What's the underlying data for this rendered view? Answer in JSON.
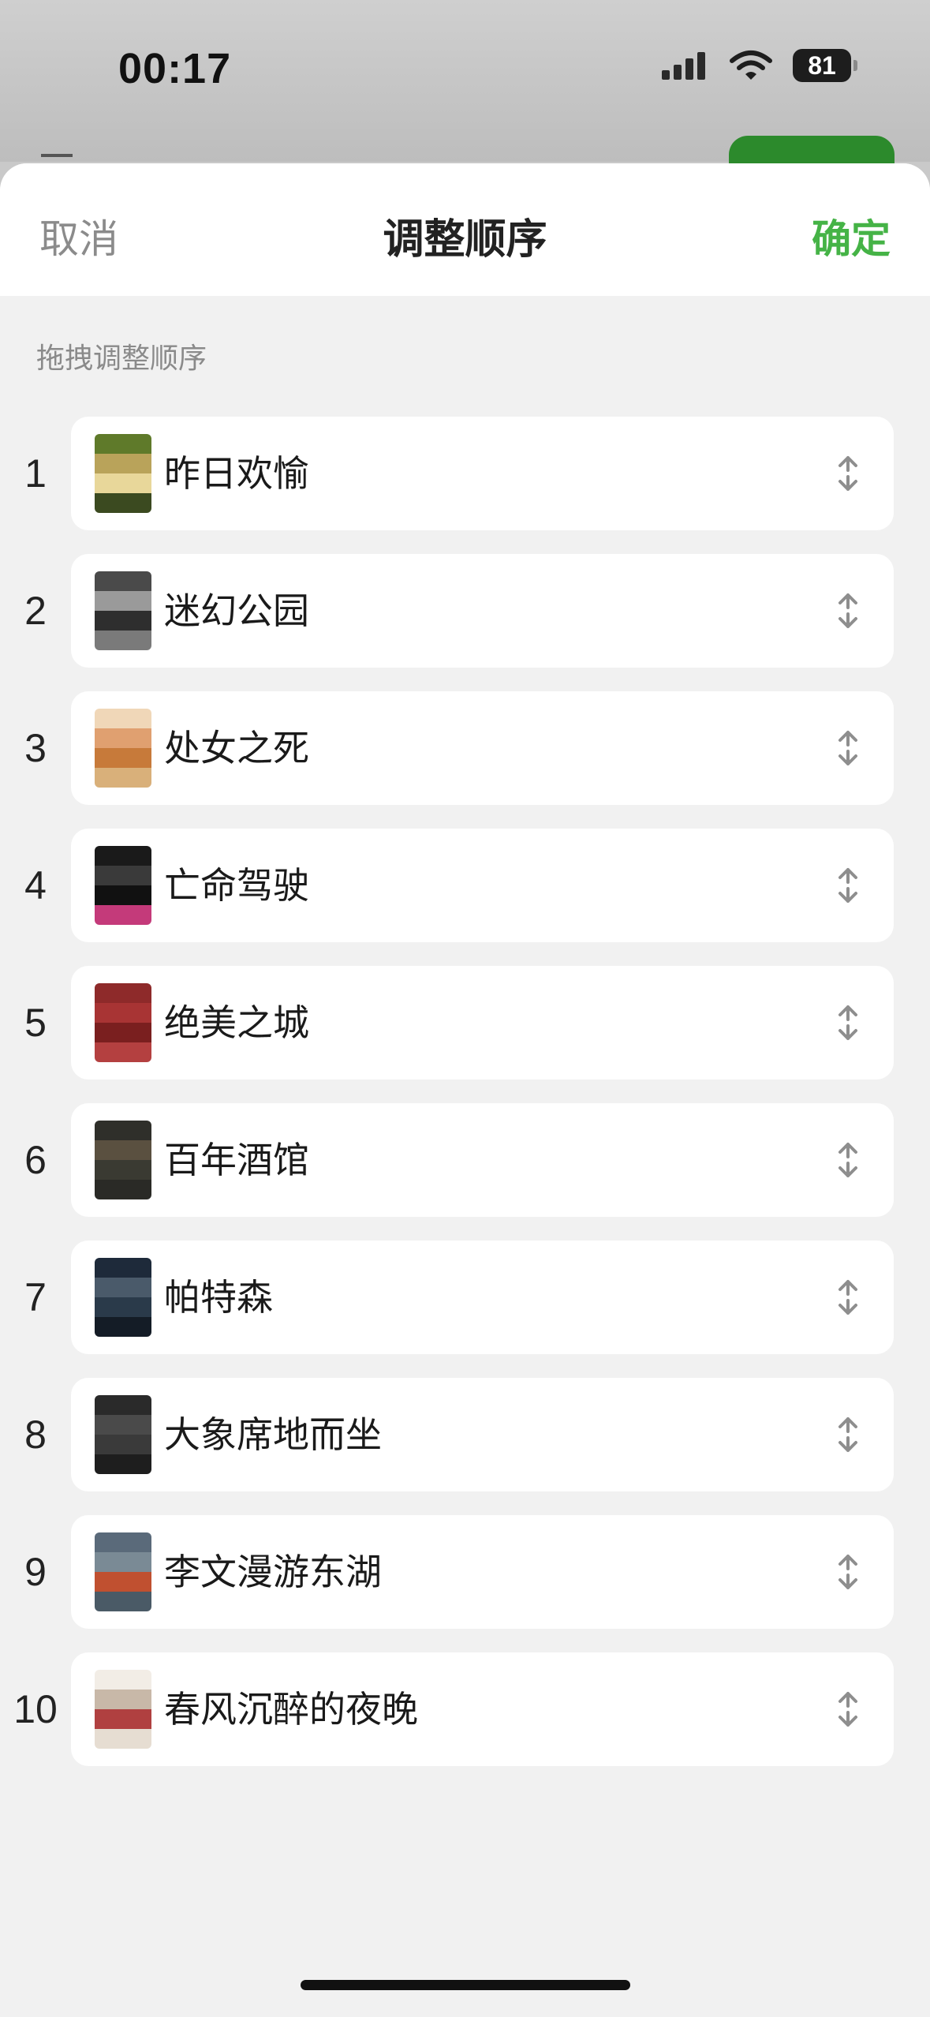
{
  "status_bar": {
    "time": "00:17",
    "battery": "81",
    "icons": [
      "cellular-signal-icon",
      "wifi-icon",
      "battery-icon"
    ]
  },
  "sheet": {
    "cancel_label": "取消",
    "title": "调整顺序",
    "confirm_label": "确定",
    "hint": "拖拽调整顺序",
    "accent_color": "#45b346"
  },
  "items": [
    {
      "index": "1",
      "title": "昨日欢愉",
      "poster_colors": [
        "#5f7a2a",
        "#b9a35a",
        "#e8d79a",
        "#3b4a20"
      ]
    },
    {
      "index": "2",
      "title": "迷幻公园",
      "poster_colors": [
        "#4a4a4a",
        "#9a9a9a",
        "#2e2e2e",
        "#7a7a7a"
      ]
    },
    {
      "index": "3",
      "title": "处女之死",
      "poster_colors": [
        "#f0d7b8",
        "#e0a070",
        "#c77a3a",
        "#d9b07a"
      ]
    },
    {
      "index": "4",
      "title": "亡命驾驶",
      "poster_colors": [
        "#1a1a1a",
        "#3a3a3a",
        "#111111",
        "#c43a7a"
      ]
    },
    {
      "index": "5",
      "title": "绝美之城",
      "poster_colors": [
        "#8e2a2a",
        "#a83434",
        "#7a1f1f",
        "#b44040"
      ]
    },
    {
      "index": "6",
      "title": "百年酒馆",
      "poster_colors": [
        "#2f2f2a",
        "#5a5040",
        "#3a3a32",
        "#2a2a26"
      ]
    },
    {
      "index": "7",
      "title": "帕特森",
      "poster_colors": [
        "#1e2a3a",
        "#4a5a6a",
        "#2a3a4a",
        "#141c26"
      ]
    },
    {
      "index": "8",
      "title": "大象席地而坐",
      "poster_colors": [
        "#2a2a2a",
        "#4a4a4a",
        "#3a3a3a",
        "#1e1e1e"
      ]
    },
    {
      "index": "9",
      "title": "李文漫游东湖",
      "poster_colors": [
        "#5a6a7a",
        "#7a8a95",
        "#c05030",
        "#4a5a66"
      ]
    },
    {
      "index": "10",
      "title": "春风沉醉的夜晚",
      "poster_colors": [
        "#f2ede6",
        "#c8b8a8",
        "#b04040",
        "#e6ddd2"
      ]
    }
  ]
}
